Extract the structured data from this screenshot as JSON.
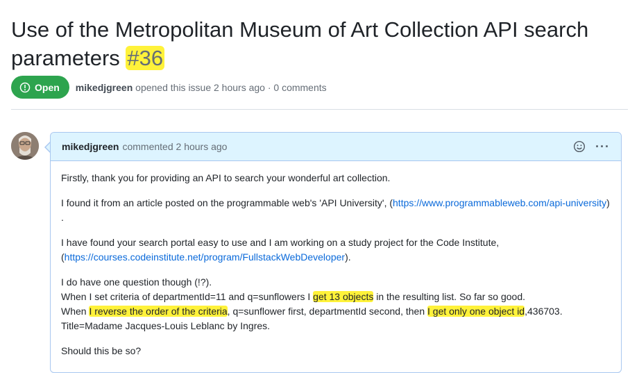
{
  "issue": {
    "title": "Use of the Metropolitan Museum of Art Collection API search parameters",
    "number": "#36",
    "status": "Open",
    "author": "mikedjgreen",
    "opened_text": "opened this issue 2 hours ago · 0 comments"
  },
  "comment": {
    "author": "mikedjgreen",
    "meta": "commented 2 hours ago",
    "p1": "Firstly, thank you for providing an API to search your wonderful art collection.",
    "p2_before": "I found it from an article posted on the programmable web's 'API University', (",
    "p2_link": "https://www.programmableweb.com/api-university",
    "p2_after": ") .",
    "p3_before": "I have found your search portal easy to use and I am working on a study project for the Code Institute, (",
    "p3_link": "https://courses.codeinstitute.net/program/FullstackWebDeveloper",
    "p3_after": ").",
    "p4_line1": "I do have one question though (!?).",
    "p4_line2_a": "When I set criteria of departmentId=11 and q=sunflowers I ",
    "p4_line2_hl": "get 13 objects",
    "p4_line2_b": " in the resulting list. So far so good.",
    "p4_line3_a": "When ",
    "p4_line3_hl1": "I reverse the order of the criteria",
    "p4_line3_b": ", q=sunflower first, departmentId second, then ",
    "p4_line3_hl2": "I get only one object id",
    "p4_line3_c": ",436703.",
    "p4_line4": "Title=Madame Jacques-Louis Leblanc by Ingres.",
    "p5": "Should this be so?"
  },
  "colors": {
    "open_green": "#2da44e",
    "link_blue": "#0969da",
    "highlight": "#fff23a",
    "header_bg": "#ddf4ff"
  },
  "icons": [
    "issue-open-icon",
    "smiley-icon",
    "kebab-menu-icon"
  ]
}
